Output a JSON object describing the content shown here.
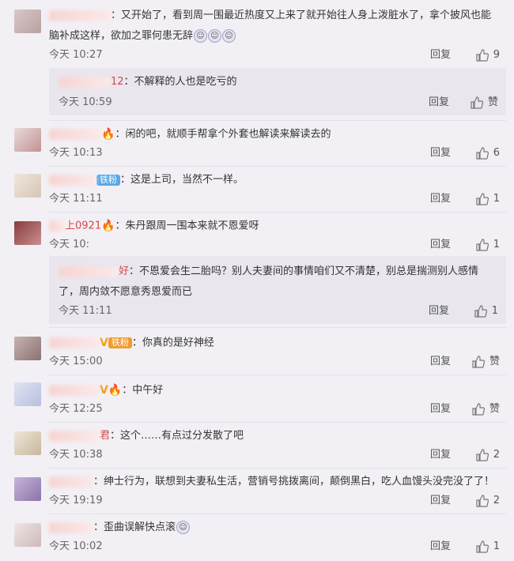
{
  "comments": [
    {
      "name_tail": "",
      "text": "：又开始了，看到周一围最近热度又上来了就开始往人身上泼脏水了，拿个披风也能",
      "text2": "脑补成这样，欲加之罪何患无辞",
      "time": "今天 10:27",
      "reply": "回复",
      "like": "9"
    },
    {
      "name_tail": "12",
      "text": "：不解释的人也是吃亏的",
      "time": "今天 10:59",
      "reply": "回复",
      "like": "赞"
    },
    {
      "name_tail": "",
      "text": "：闲的吧，就顺手帮拿个外套也解读来解读去的",
      "time": "今天 10:13",
      "reply": "回复",
      "like": "6"
    },
    {
      "badge": "铁粉",
      "text": "：这是上司，当然不一样。",
      "time": "今天 11:11",
      "reply": "回复",
      "like": "1"
    },
    {
      "name_tail": "上0921",
      "name_head": "...",
      "text": "：朱丹跟周一围本来就不恩爱呀",
      "time": "今天 10:",
      "reply": "回复",
      "like": "1"
    },
    {
      "name_tail": "好",
      "text": "：不恩爱会生二胎吗？别人夫妻间的事情咱们又不清楚，别总是揣测别人感情",
      "text2": "了，周内敛不愿意秀恩爱而已",
      "time": "今天 11:11",
      "reply": "回复",
      "like": "1"
    },
    {
      "badge": "铁粉",
      "text": "：你真的是好神经",
      "time": "今天 15:00",
      "reply": "回复",
      "like": "赞"
    },
    {
      "text": "：中午好",
      "time": "今天 12:25",
      "reply": "回复",
      "like": "赞"
    },
    {
      "name_tail": "君",
      "text": "：这个……有点过分发散了吧",
      "time": "今天 10:38",
      "reply": "回复",
      "like": "2"
    },
    {
      "text": "：绅士行为，联想到夫妻私生活，营销号挑拨离间，颠倒黑白，吃人血馒头没完没了了！",
      "time": "今天 19:19",
      "reply": "回复",
      "like": "2"
    },
    {
      "text": "：歪曲误解快点滚",
      "time": "今天 10:02",
      "reply": "回复",
      "like": "1"
    }
  ],
  "colors": {
    "fan_badge": "#5aa8e8",
    "fan_badge2": "#f29b2b",
    "vip": "#f0a018",
    "bg": "#f2f0f5",
    "reply_bg": "#e9e6ee"
  },
  "icons": {
    "like": "thumb-up-icon",
    "emoji": "sticker-emoji-icon",
    "hot": "fire-icon"
  }
}
